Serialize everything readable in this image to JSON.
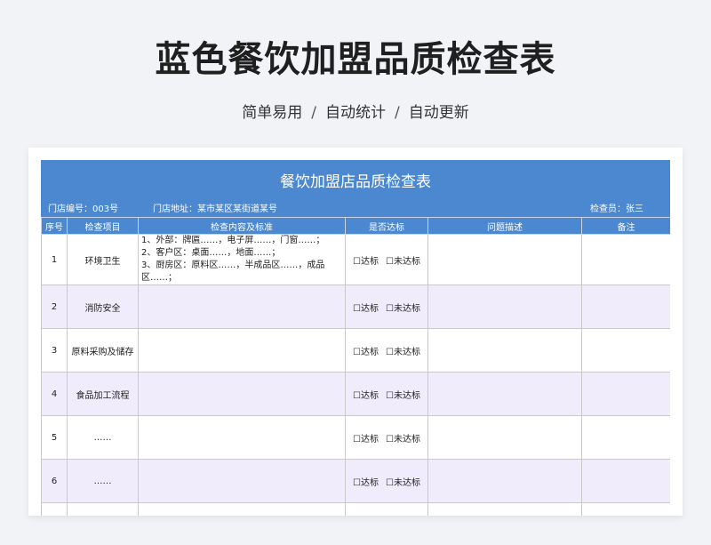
{
  "hero": {
    "title": "蓝色餐饮加盟品质检查表",
    "subtitle": [
      "简单易用",
      "自动统计",
      "自动更新"
    ],
    "separator": "/"
  },
  "sheet": {
    "title": "餐饮加盟店品质检查表",
    "store_no": "门店编号：003号",
    "store_address": "门店地址：某市某区某街道某号",
    "inspector": "检查员：张三",
    "columns": [
      "序号",
      "检查项目",
      "检查内容及标准",
      "是否达标",
      "问题描述",
      "备注"
    ],
    "option_pass": "☐达标",
    "option_fail": "☐未达标",
    "rows": [
      {
        "no": "1",
        "item": "环境卫生",
        "content": [
          "1、外部：牌匾……，电子屏……，门窗……；",
          "2、客户区：桌面……，地面……；",
          "3、厨房区：原料区……，半成品区……，成品区……；"
        ]
      },
      {
        "no": "2",
        "item": "消防安全",
        "content": []
      },
      {
        "no": "3",
        "item": "原料采购及储存",
        "content": []
      },
      {
        "no": "4",
        "item": "食品加工流程",
        "content": []
      },
      {
        "no": "5",
        "item": "……",
        "content": []
      },
      {
        "no": "6",
        "item": "……",
        "content": []
      }
    ]
  }
}
